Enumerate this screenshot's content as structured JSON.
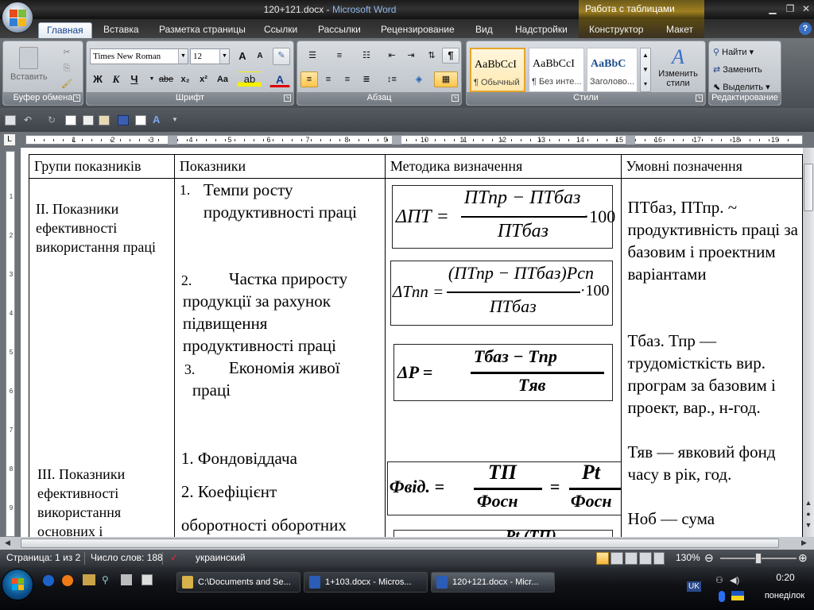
{
  "window": {
    "title_doc": "120+121.docx",
    "title_sep": " - ",
    "title_app": "Microsoft Word",
    "context_title": "Работа с таблицами"
  },
  "tabs": [
    "Главная",
    "Вставка",
    "Разметка страницы",
    "Ссылки",
    "Рассылки",
    "Рецензирование",
    "Вид",
    "Надстройки",
    "Конструктор",
    "Макет"
  ],
  "ribbon": {
    "clipboard": {
      "label": "Буфер обмена",
      "paste": "Вставить"
    },
    "font": {
      "label": "Шрифт",
      "font_name": "Times New Roman",
      "font_size": "12",
      "bold": "Ж",
      "italic": "К",
      "underline": "Ч",
      "strike": "abe",
      "sub": "x₂",
      "sup": "x²",
      "case": "Aa",
      "grow": "A",
      "shrink": "A",
      "color_a": "A"
    },
    "paragraph": {
      "label": "Абзац",
      "pilcrow": "¶"
    },
    "styles": {
      "label": "Стили",
      "items": [
        {
          "sample": "AaBbCcI",
          "name": "¶ Обычный"
        },
        {
          "sample": "AaBbCcI",
          "name": "¶ Без инте..."
        },
        {
          "sample": "AaBbC",
          "name": "Заголово..."
        }
      ],
      "change_styles": "Изменить стили"
    },
    "editing": {
      "label": "Редактирование",
      "find": "Найти",
      "replace": "Заменить",
      "select": "Выделить"
    }
  },
  "ruler": {
    "numbers": [
      "1",
      "1",
      "2",
      "3",
      "4",
      "5",
      "6",
      "7",
      "8",
      "9",
      "10",
      "11",
      "12",
      "13",
      "14",
      "15",
      "16",
      "17",
      "18",
      "19"
    ]
  },
  "vruler": {
    "numbers": [
      "1",
      "2",
      "3",
      "4",
      "5",
      "6",
      "7",
      "8",
      "9"
    ]
  },
  "table": {
    "headers": [
      "Групи показників",
      "Показники",
      "Методика визначення",
      "Умовні позначення"
    ],
    "group2": "II. Показники ефективності використання праці",
    "group3": "III. Показники ефективності використання основних і",
    "ind1_num": "1.",
    "ind1": "Темпи росту продуктивності праці",
    "ind2_num": "2.",
    "ind2": "Частка приросту продукції за рахунок підвищення продуктивності праці",
    "ind3_num": "3.",
    "ind3": "Економія живої праці",
    "ind4": "1. Фондовіддача",
    "ind5": "2. Коефіцієнт",
    "ind5b": "оборотності оборотних",
    "notes": [
      "ПТбаз, ПТпр. ~ продуктивність праці за базовим і проектним варіантами",
      "Тбаз. Тпр — трудомісткість вир. програм за базовим і проект, вар., н-год.",
      "Тяв — явковий фонд часу в рік, год.",
      "Ноб — сума"
    ],
    "formulas": {
      "f1_lhs": "ΔПТ =",
      "f1_num": "ПТпр − ПТбаз",
      "f1_den": "ПТбаз",
      "f1_mul": "·100",
      "f2_lhs": "ΔTпп =",
      "f2_num": "(ПТпр − ПТбаз)Pсп",
      "f2_den": "ПТбаз",
      "f2_mul": "·100",
      "f3_lhs": "ΔP =",
      "f3_num": "Tбаз − Tпр",
      "f3_den": "Tяв",
      "f4_lhs": "Фвід. =",
      "f4_n1": "ТП",
      "f4_d1": "Фосн",
      "f4_n2": "Pt",
      "f4_d2": "Фосн",
      "f4_eq": "=",
      "f5_partial": "Pt (ТП)"
    }
  },
  "status": {
    "page": "Страница: 1 из 2",
    "words": "Число слов: 188",
    "lang": "украинский",
    "zoom": "130%"
  },
  "taskbar": {
    "items": [
      "C:\\Documents and Se...",
      "1+103.docx - Micros...",
      "120+121.docx - Micr..."
    ],
    "lang": "UK",
    "time": "0:20",
    "day": "понеділок"
  },
  "colors": {
    "accent": "#15428b",
    "selected_style": "#e5a52b",
    "titlebar": "#1f1f1f"
  }
}
